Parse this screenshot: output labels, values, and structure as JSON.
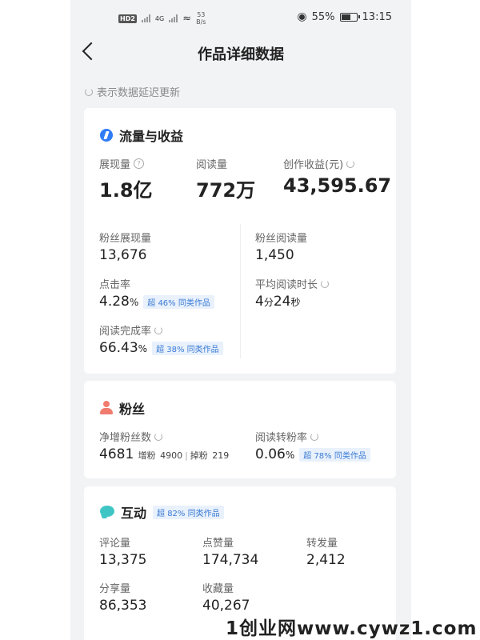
{
  "status_bar": {
    "network_badge_a": "HD",
    "network_badge_b": "2",
    "network_type": "4G",
    "speed_value": "53",
    "speed_unit": "B/s",
    "battery": "55%",
    "time": "13:15"
  },
  "nav": {
    "title": "作品详细数据"
  },
  "notice": "表示数据延迟更新",
  "traffic": {
    "title": "流量与收益",
    "impressions": {
      "label": "展现量",
      "value": "1.8亿"
    },
    "reads": {
      "label": "阅读量",
      "value": "772万"
    },
    "revenue": {
      "label": "创作收益(元)",
      "value": "43,595.67"
    },
    "fan_impressions": {
      "label": "粉丝展现量",
      "value": "13,676"
    },
    "fan_reads": {
      "label": "粉丝阅读量",
      "value": "1,450"
    },
    "ctr": {
      "label": "点击率",
      "value": "4.28",
      "unit": "%",
      "badge": "超 46% 同类作品"
    },
    "avg_read_time": {
      "label": "平均阅读时长",
      "value_a": "4",
      "unit_a": "分",
      "value_b": "24",
      "unit_b": "秒"
    },
    "completion": {
      "label": "阅读完成率",
      "value": "66.43",
      "unit": "%",
      "badge": "超 38% 同类作品"
    }
  },
  "fans": {
    "title": "粉丝",
    "net_gain": {
      "label": "净增粉丝数",
      "value": "4681",
      "gain_label": "增粉",
      "gain_value": "4900",
      "loss_label": "掉粉",
      "loss_value": "219"
    },
    "conversion": {
      "label": "阅读转粉率",
      "value": "0.06",
      "unit": "%",
      "badge": "超 78% 同类作品"
    }
  },
  "interaction": {
    "title": "互动",
    "badge": "超 82% 同类作品",
    "comments": {
      "label": "评论量",
      "value": "13,375"
    },
    "likes": {
      "label": "点赞量",
      "value": "174,734"
    },
    "reposts": {
      "label": "转发量",
      "value": "2,412"
    },
    "shares": {
      "label": "分享量",
      "value": "86,353"
    },
    "favorites": {
      "label": "收藏量",
      "value": "40,267"
    }
  },
  "watermark": "1创业网www.cywz1.com",
  "colors": {
    "accent_blue": "#2f7cf6",
    "fans_icon": "#f07c6f",
    "interact_icon": "#3fc6c4",
    "badge_text": "#3a7bd5",
    "page_bg": "#f2f3f5"
  }
}
